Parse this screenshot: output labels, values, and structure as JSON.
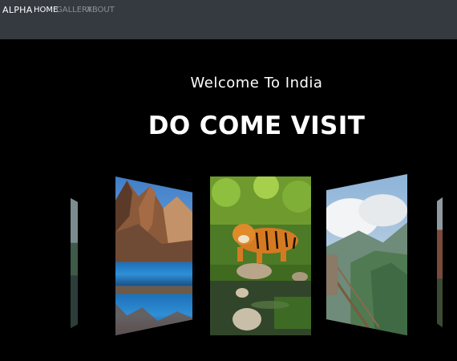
{
  "navbar": {
    "brand": "ALPHA",
    "links": [
      {
        "label": "HOME",
        "active": true
      },
      {
        "label": "GALLERY",
        "active": false
      },
      {
        "label": "ABOUT",
        "active": false
      }
    ],
    "background": "#343a40"
  },
  "hero": {
    "subtitle": "Welcome To India",
    "title": "DO COME VISIT"
  },
  "carousel": {
    "images": [
      {
        "name": "partial-lake-photo"
      },
      {
        "name": "mountain-lake-photo"
      },
      {
        "name": "tiger-photo"
      },
      {
        "name": "misty-forest-photo"
      },
      {
        "name": "partial-forest-photo"
      }
    ]
  },
  "colors": {
    "page_background": "#000000",
    "text_primary": "#ffffff",
    "nav_inactive": "#8b9095"
  }
}
